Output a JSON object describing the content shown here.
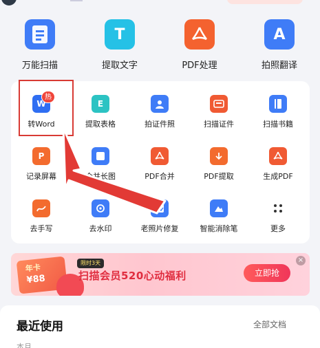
{
  "big_tools": [
    {
      "label": "万能扫描",
      "icon": "scan-doc-icon",
      "glyph": "",
      "color": "#3f7cf7"
    },
    {
      "label": "提取文字",
      "icon": "text-extract-icon",
      "glyph": "T",
      "color": "#25c1e6"
    },
    {
      "label": "PDF处理",
      "icon": "pdf-icon",
      "glyph": "",
      "color": "#f4622f"
    },
    {
      "label": "拍照翻译",
      "icon": "translate-icon",
      "glyph": "A",
      "color": "#3f7cf7"
    }
  ],
  "small_tools": [
    {
      "label": "转Word",
      "glyph": "W",
      "color": "#2f6ef2",
      "badge": "热"
    },
    {
      "label": "提取表格",
      "glyph": "E",
      "color": "#2cc3c3"
    },
    {
      "label": "拍证件照",
      "glyph": "",
      "color": "#3f7cf7"
    },
    {
      "label": "扫描证件",
      "glyph": "",
      "color": "#f05a33"
    },
    {
      "label": "扫描书籍",
      "glyph": "",
      "color": "#3f7cf7"
    },
    {
      "label": "记录屏幕",
      "glyph": "P",
      "color": "#f36b2e"
    },
    {
      "label": "合并长图",
      "glyph": "",
      "color": "#3f7cf7"
    },
    {
      "label": "PDF合并",
      "glyph": "",
      "color": "#f05a33"
    },
    {
      "label": "PDF提取",
      "glyph": "",
      "color": "#f36b2e"
    },
    {
      "label": "生成PDF",
      "glyph": "",
      "color": "#f05a33"
    },
    {
      "label": "去手写",
      "glyph": "",
      "color": "#f36b2e"
    },
    {
      "label": "去水印",
      "glyph": "",
      "color": "#3f7cf7"
    },
    {
      "label": "老照片修复",
      "glyph": "",
      "color": "#3f7cf7"
    },
    {
      "label": "智能消除笔",
      "glyph": "",
      "color": "#3f7cf7"
    },
    {
      "label": "更多",
      "glyph": "",
      "color": "#333333"
    }
  ],
  "banner": {
    "card_title": "年卡",
    "card_price": "¥88",
    "tag": "限时3天",
    "text": "扫描会员520心动福利",
    "button": "立即抢",
    "close": "×"
  },
  "recent": {
    "title": "最近使用",
    "all_docs": "全部文档",
    "sub": "本月"
  },
  "colors": {
    "accent_red": "#d83a34",
    "brand_blue": "#3f7cf7"
  }
}
